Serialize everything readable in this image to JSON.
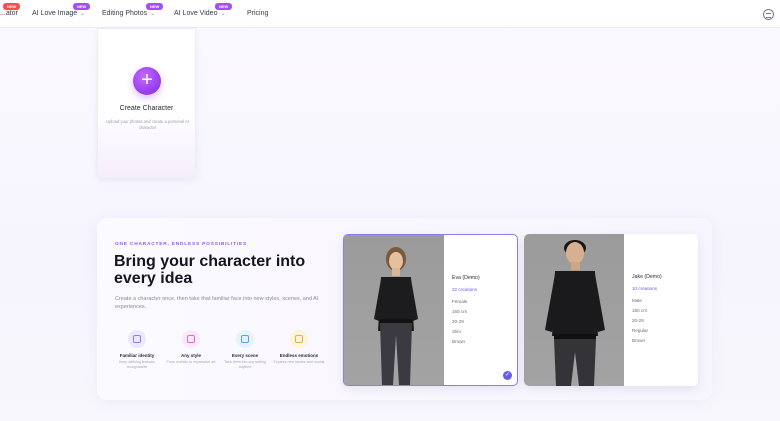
{
  "nav": {
    "items": [
      {
        "label": "...ator",
        "badge": "NEW",
        "badge_color": "red",
        "has_chevron": false
      },
      {
        "label": "AI Love Image",
        "badge": "NEW",
        "badge_color": "purple",
        "has_chevron": true
      },
      {
        "label": "Editing Photos",
        "badge": "NEW",
        "badge_color": "purple",
        "has_chevron": true
      },
      {
        "label": "AI Love Video",
        "badge": "NEW",
        "badge_color": "purple",
        "has_chevron": true
      },
      {
        "label": "Pricing",
        "badge": "",
        "has_chevron": false
      }
    ]
  },
  "create_card": {
    "icon": "plus-icon",
    "title": "Create Character",
    "description": "Upload your photos and create a personal AI character"
  },
  "feature": {
    "eyebrow": "ONE CHARACTER, ENDLESS POSSIBILITIES",
    "headline": "Bring your character into every idea",
    "subtext": "Create a character once, then take that familiar face into new styles, scenes, and AI experiences.",
    "perks": [
      {
        "icon": "identity-icon",
        "title": "Familiar identity",
        "desc": "Keep defining features recognizable",
        "color": "#8c7cf0",
        "bg": "#ece9fd"
      },
      {
        "icon": "style-icon",
        "title": "Any style",
        "desc": "From realistic to expressive art",
        "color": "#d86bd8",
        "bg": "#fbe9fb"
      },
      {
        "icon": "scene-icon",
        "title": "Every scene",
        "desc": "Take them into any setting anytime",
        "color": "#4aa8e8",
        "bg": "#e6f3fd"
      },
      {
        "icon": "emotion-icon",
        "title": "Endless emotions",
        "desc": "Express new stories and moods",
        "color": "#e8b23a",
        "bg": "#fdf4dc"
      }
    ]
  },
  "characters": [
    {
      "name": "Eva (Demo)",
      "count": "22 creations",
      "details": [
        "Female",
        "165 cm",
        "20-29",
        "Slim",
        "Brown"
      ],
      "selected": true,
      "gender": "female"
    },
    {
      "name": "Jake (Demo)",
      "count": "10 creations",
      "details": [
        "Male",
        "180 cm",
        "20-29",
        "Regular",
        "Brown"
      ],
      "selected": false,
      "gender": "male"
    }
  ]
}
